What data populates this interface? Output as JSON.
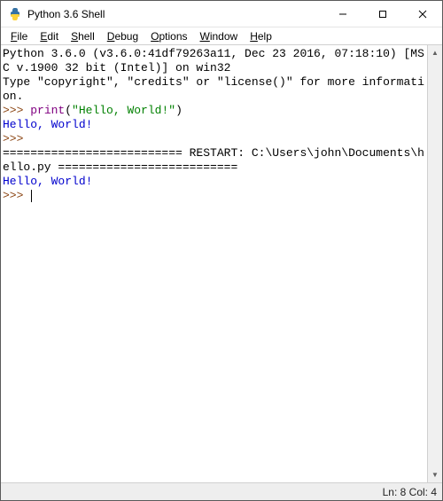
{
  "window": {
    "title": "Python 3.6 Shell"
  },
  "menu": {
    "file": {
      "label": "File",
      "accel": "F",
      "rest": "ile"
    },
    "edit": {
      "label": "Edit",
      "accel": "E",
      "rest": "dit"
    },
    "shell": {
      "label": "Shell",
      "accel": "S",
      "rest": "hell"
    },
    "debug": {
      "label": "Debug",
      "accel": "D",
      "rest": "ebug"
    },
    "options": {
      "label": "Options",
      "accel": "O",
      "rest": "ptions"
    },
    "window": {
      "label": "Window",
      "accel": "W",
      "rest": "indow"
    },
    "help": {
      "label": "Help",
      "accel": "H",
      "rest": "elp"
    }
  },
  "shell": {
    "banner_line1": "Python 3.6.0 (v3.6.0:41df79263a11, Dec 23 2016, 07:18:10) [MSC v.1900 32 bit (Intel)] on win32",
    "banner_line2": "Type \"copyright\", \"credits\" or \"license()\" for more information.",
    "prompt": ">>> ",
    "print_func": "print",
    "open_paren": "(",
    "arg_string": "\"Hello, World!\"",
    "close_paren": ")",
    "output1": "Hello, World!",
    "restart_line": "========================== RESTART: C:\\Users\\john\\Documents\\hello.py ==========================",
    "output2": "Hello, World!"
  },
  "status": {
    "text": "Ln: 8  Col: 4"
  }
}
